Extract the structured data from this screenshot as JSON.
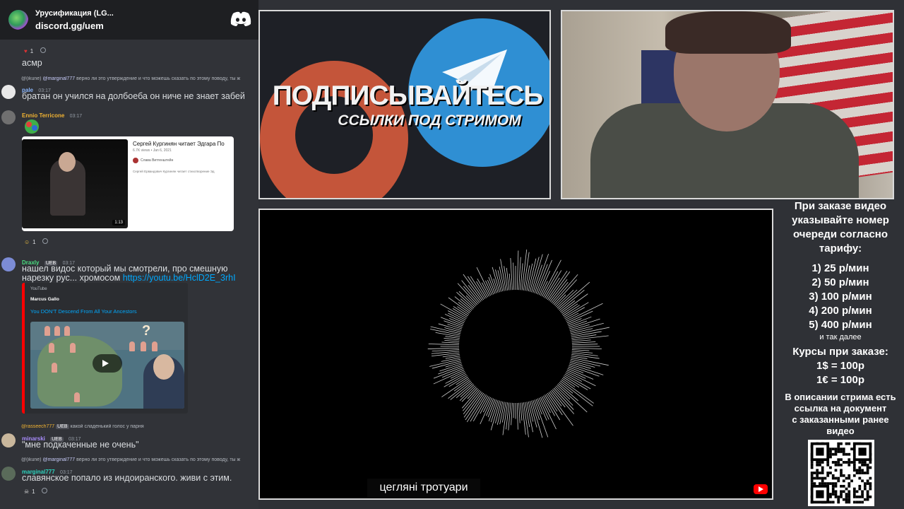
{
  "discord": {
    "server_name": "Урусификация (LG...",
    "invite": "discord.gg/uem",
    "messages": {
      "r1_count": "1",
      "asmr": "асмр",
      "reply1_user": "@(ikune)",
      "reply1_mention": "@marginal777",
      "reply1_text": "верно ли это утверждение и что можешь сказать по этому поводу, ты ж",
      "pale_name": "pale",
      "pale_time": "03:17",
      "pale_text": "братан он учился на долбоеба он ниче не знает забей",
      "ennio_name": "Ennio Terricone",
      "ennio_time": "03:17",
      "embed1_title": "Сергей Кургинян читает Эдгара По",
      "embed1_meta": "6.7K views • Jan 6, 2021",
      "embed1_author": "Слава Витгенштейн",
      "embed1_desc": "Сергей Ервандович Кургинян читает стихотворение Эд",
      "embed1_duration": "1:13",
      "r2_count": "1",
      "draxly_name": "Draxly",
      "draxly_tag": "UEB",
      "draxly_time": "03:17",
      "draxly_text1": "нашел видос который мы смотрели, про смешную",
      "draxly_text2": "нарезку рус... хромосом",
      "draxly_link": "https://youtu.be/HclD2E_3rhI",
      "yt_provider": "YouTube",
      "yt_author": "Marcus Gallo",
      "yt_title": "You DON'T Descend From All Your Ancestors",
      "reply2_user": "@rasseech777",
      "reply2_tag": "UEB",
      "reply2_text": "какой сладенький голос у парня",
      "minarski_name": "minarski",
      "minarski_tag": "UEB",
      "minarski_time": "03:17",
      "minarski_text": "\"мне подкаченные не очень\"",
      "reply3_user": "@(ikune)",
      "reply3_mention": "@marginal777",
      "reply3_text": "верно ли это утверждение и что можешь сказать по этому поводу, ты ж",
      "marginal_name": "marginal777",
      "marginal_time": "03:17",
      "marginal_text": "славянское попало из индоиранского. живи с этим.",
      "r3_count": "1"
    }
  },
  "promo": {
    "main": "ПОДПИСЫВАЙТЕСЬ",
    "sub": "ССЫЛКИ ПОД СТРИМОМ"
  },
  "visualizer": {
    "subtitle": "цегляні тротуари"
  },
  "info": {
    "l1": "При заказе видео",
    "l2": "указывайте номер",
    "l3": "очереди согласно",
    "l4": "тарифу:",
    "t1": "1) 25 р/мин",
    "t2": "2) 50 р/мин",
    "t3": "3) 100 р/мин",
    "t4": "4) 200 р/мин",
    "t5": "5) 400 р/мин",
    "etc": "и так далее",
    "rates_title": "Курсы при заказе:",
    "usd": "1$ = 100р",
    "eur": "1€ = 100р",
    "d1": "В описании стрима есть",
    "d2": "ссылка на документ",
    "d3": "с заказанными ранее",
    "d4": "видео"
  },
  "colors": {
    "discord_bg": "#313338",
    "link": "#00a8fc",
    "youtube_red": "#ff0000"
  }
}
